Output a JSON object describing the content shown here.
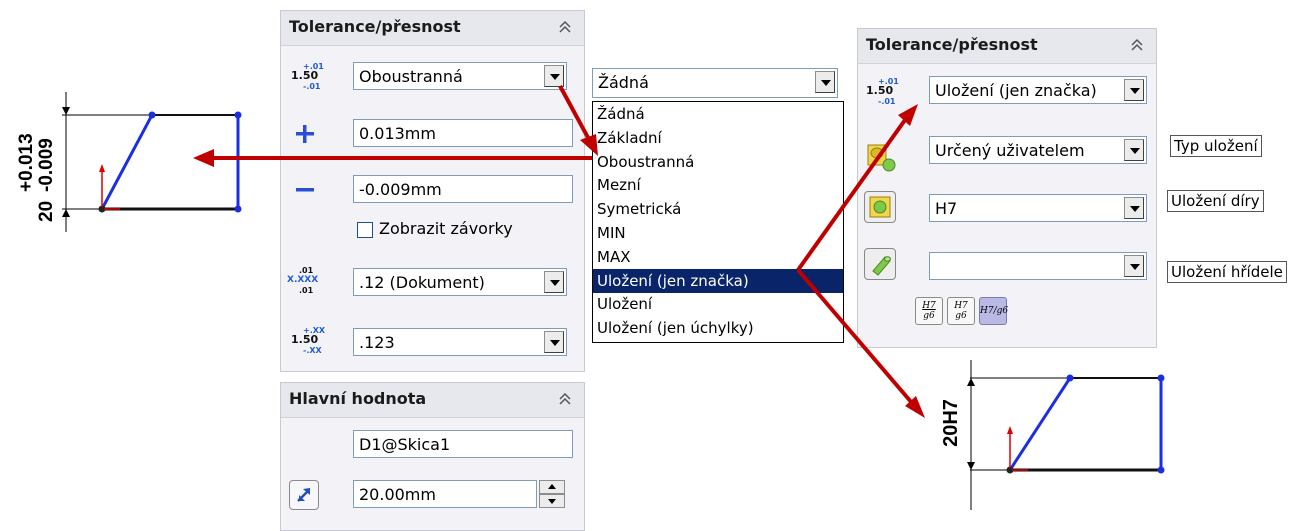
{
  "panel1": {
    "title": "Tolerance/přesnost",
    "tol_icon": {
      "base": "1.50",
      "up": "+.01",
      "dn": "-.01"
    },
    "tolerance_type": "Oboustranná",
    "upper_value": "0.013mm",
    "lower_value": "-0.009mm",
    "show_brackets_label": "Zobrazit závorky",
    "show_brackets_checked": false,
    "precision_icon": {
      "base": "X.XXX",
      "up": ".01",
      "dn": ".01"
    },
    "primary_precision": ".12 (Dokument)",
    "tol_precision_icon": {
      "base": "1.50",
      "up": "+.XX",
      "dn": "-.XX"
    },
    "tolerance_precision": ".123"
  },
  "panel2": {
    "title": "Hlavní hodnota",
    "dimension_name": "D1@Skica1",
    "value": "20.00mm"
  },
  "dropdown": {
    "selected": "Žádná",
    "options": [
      "Žádná",
      "Základní",
      "Oboustranná",
      "Mezní",
      "Symetrická",
      "MIN",
      "MAX",
      "Uložení (jen značka)",
      "Uložení",
      "Uložení (jen úchylky)"
    ],
    "highlighted_index": 7
  },
  "panel3": {
    "title": "Tolerance/přesnost",
    "tol_icon": {
      "base": "1.50",
      "up": "+.01",
      "dn": "-.01"
    },
    "tolerance_type": "Uložení (jen značka)",
    "fit_type": "Určený uživatelem",
    "hole_fit": "H7",
    "shaft_fit": "",
    "fit_buttons": [
      {
        "top": "H7",
        "bottom": "g6"
      },
      {
        "top": "H7",
        "bottom": "g6"
      },
      {
        "top": "H7/g6",
        "bottom": ""
      }
    ]
  },
  "annotations": {
    "fit_type_label": "Typ uložení",
    "hole_fit_label": "Uložení díry",
    "shaft_fit_label": "Uložení hřídele"
  },
  "sketch_left": {
    "dimension_text": "20",
    "upper_tol": "+0.013",
    "lower_tol": "-0.009"
  },
  "sketch_right": {
    "dimension_text": "20H7"
  },
  "colors": {
    "arrow": "#c00000",
    "sketch_line": "#1a2fe0",
    "selection": "#0a246a"
  }
}
